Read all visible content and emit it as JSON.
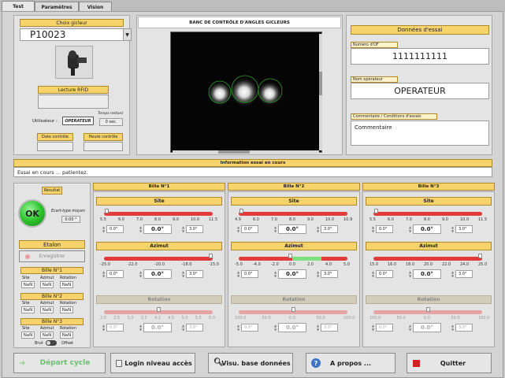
{
  "tabs": [
    "Test",
    "Paramètres",
    "Vision"
  ],
  "choix_gicleur": {
    "label": "Choix gicleur",
    "value": "P10023"
  },
  "lecture_rfid": {
    "label": "Lecture RFID",
    "value": ""
  },
  "utilisateur": {
    "label": "Utilisateur :",
    "value": "OPERATEUR"
  },
  "temps_restant": {
    "label": "Temps restant",
    "value": "0 sec."
  },
  "date_controle": {
    "label": "Date contrôle",
    "value": ""
  },
  "heure_controle": {
    "label": "Heure contrôle",
    "value": ""
  },
  "banc": {
    "title": "BANC DE CONTRÔLE D'ANGLES GICLEURS"
  },
  "donnees": {
    "title": "Données d'essai",
    "of_label": "Numéro d'OF",
    "of_value": "1111111111",
    "nom_label": "Nom opérateur",
    "nom_value": "OPERATEUR",
    "comment_label": "Commentaire / Conditions d'essais",
    "comment_value": "Commentaire"
  },
  "info": {
    "title": "Information essai en cours",
    "message": "Essai en cours ... patientez."
  },
  "resultat": {
    "label": "Résultat",
    "ok": "OK",
    "ecart_label": "Ecart-type moyen",
    "ecart_value": "0.00 °"
  },
  "etalon": {
    "title": "Etalon",
    "enregistrer": "Enregistrer",
    "col_headers": [
      "Site",
      "Azimut",
      "Rotation"
    ],
    "billes": [
      {
        "name": "Bille N°1",
        "values": [
          "NaN",
          "NaN",
          "NaN"
        ]
      },
      {
        "name": "Bille N°2",
        "values": [
          "NaN",
          "NaN",
          "NaN"
        ]
      },
      {
        "name": "Bille N°3",
        "values": [
          "NaN",
          "NaN",
          "NaN"
        ]
      }
    ],
    "brut": "Brut",
    "offset": "Offset"
  },
  "billes": [
    {
      "name": "Bille N°1",
      "site": {
        "title": "Site",
        "ticks": [
          "5.5",
          "6.0",
          "7.0",
          "8.0",
          "9.0",
          "10.0",
          "11.5"
        ],
        "left": "0.0°",
        "center": "0.0°",
        "right": "3.0°"
      },
      "azimut": {
        "title": "Azimut",
        "ticks": [
          "-25.0",
          "-22.0",
          "-20.0",
          "-18.0",
          "-15.0"
        ],
        "left": "0.0°",
        "center": "0.0°",
        "right": "3.0°"
      },
      "rotation": {
        "title": "Rotation",
        "ticks": [
          "2.0",
          "2.5",
          "3.0",
          "3.5",
          "4.1",
          "4.5",
          "5.0",
          "5.5",
          "6.0"
        ],
        "left": "0.0°",
        "center": "0.0°",
        "right": "3.0°"
      }
    },
    {
      "name": "Bille N°2",
      "site": {
        "title": "Site",
        "ticks": [
          "4.9",
          "6.0",
          "7.0",
          "8.0",
          "9.0",
          "10.0",
          "10.9"
        ],
        "left": "0.0°",
        "center": "0.0°",
        "right": "3.0°"
      },
      "azimut": {
        "title": "Azimut",
        "ticks": [
          "-5.0",
          "-4.0",
          "-2.0",
          "0.0",
          "2.0",
          "4.0",
          "5.0"
        ],
        "left": "0.0°",
        "center": "0.0°",
        "right": "3.0°"
      },
      "rotation": {
        "title": "Rotation",
        "ticks": [
          "100.0",
          "50.0",
          "0.0",
          "50.0",
          "100.0"
        ],
        "left": "0.0°",
        "center": "0.0°",
        "right": "3.0°"
      }
    },
    {
      "name": "Bille N°3",
      "site": {
        "title": "Site",
        "ticks": [
          "5.5",
          "6.0",
          "7.0",
          "8.0",
          "9.0",
          "10.0",
          "11.5"
        ],
        "left": "0.0°",
        "center": "0.0°",
        "right": "3.0°"
      },
      "azimut": {
        "title": "Azimut",
        "ticks": [
          "15.0",
          "16.0",
          "18.0",
          "20.0",
          "22.0",
          "24.0",
          "25.0"
        ],
        "left": "0.0°",
        "center": "0.0°",
        "right": "3.0°"
      },
      "rotation": {
        "title": "Rotation",
        "ticks": [
          "100.0",
          "50.0",
          "0.0",
          "50.0",
          "100.0"
        ],
        "left": "0.0°",
        "center": "0.0°",
        "right": "3.0°"
      }
    }
  ],
  "buttons": {
    "depart": "Départ cycle",
    "login": "Login niveau accès",
    "visu": "Visu. base données",
    "apropos": "A propos ...",
    "quitter": "Quitter"
  },
  "colors": {
    "accent": "#f6d36b",
    "slider": "#e23b3b",
    "ok": "#2ec42e",
    "stop": "#d62020",
    "tolerance": "#7ee07e"
  },
  "icons": [
    "arrow-right-icon",
    "lock-icon",
    "magnifier-icon",
    "question-icon",
    "stop-icon",
    "led-icon"
  ]
}
